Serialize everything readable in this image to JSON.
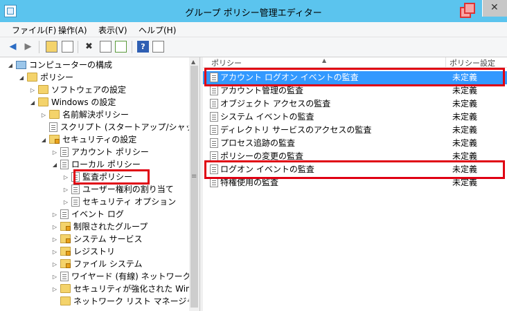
{
  "window": {
    "title": "グループ ポリシー管理エディター",
    "close_glyph": "✕"
  },
  "menubar": [
    "ファイル(F)",
    "操作(A)",
    "表示(V)",
    "ヘルプ(H)"
  ],
  "toolbar": {
    "help_glyph": "?",
    "delete_glyph": "✖"
  },
  "tree": [
    {
      "label": "コンピューターの構成",
      "icon": "computer-icon",
      "expander": "◢"
    },
    {
      "label": "ポリシー",
      "icon": "folder-icon",
      "expander": "◢"
    },
    {
      "label": "ソフトウェアの設定",
      "icon": "folder-icon",
      "expander": "▷"
    },
    {
      "label": "Windows の設定",
      "icon": "folder-icon",
      "expander": "◢"
    },
    {
      "label": "名前解決ポリシー",
      "icon": "folder-icon",
      "expander": "▷"
    },
    {
      "label": "スクリプト (スタートアップ/シャットダウ",
      "icon": "script-icon",
      "expander": ""
    },
    {
      "label": "セキュリティの設定",
      "icon": "security-folder-icon",
      "expander": "◢"
    },
    {
      "label": "アカウント ポリシー",
      "icon": "policy-icon",
      "expander": "▷"
    },
    {
      "label": "ローカル ポリシー",
      "icon": "policy-icon",
      "expander": "◢"
    },
    {
      "label": "監査ポリシー",
      "icon": "policy-icon",
      "expander": "▷"
    },
    {
      "label": "ユーザー権利の割り当て",
      "icon": "policy-icon",
      "expander": "▷"
    },
    {
      "label": "セキュリティ オプション",
      "icon": "policy-icon",
      "expander": "▷"
    },
    {
      "label": "イベント ログ",
      "icon": "policy-icon",
      "expander": "▷"
    },
    {
      "label": "制限されたグループ",
      "icon": "lock-folder-icon",
      "expander": "▷"
    },
    {
      "label": "システム サービス",
      "icon": "lock-folder-icon",
      "expander": "▷"
    },
    {
      "label": "レジストリ",
      "icon": "lock-folder-icon",
      "expander": "▷"
    },
    {
      "label": "ファイル システム",
      "icon": "lock-folder-icon",
      "expander": "▷"
    },
    {
      "label": "ワイヤード (有線) ネットワーク",
      "icon": "policy-icon",
      "expander": "▷"
    },
    {
      "label": "セキュリティが強化された Windo",
      "icon": "folder-icon",
      "expander": "▷"
    },
    {
      "label": "ネットワーク リスト マネージャー",
      "icon": "folder-icon",
      "expander": ""
    }
  ],
  "list": {
    "columns": {
      "name": "ポリシー",
      "setting": "ポリシー設定"
    },
    "rows": [
      {
        "name": "アカウント ログオン イベントの監査",
        "setting": "未定義"
      },
      {
        "name": "アカウント管理の監査",
        "setting": "未定義"
      },
      {
        "name": "オブジェクト アクセスの監査",
        "setting": "未定義"
      },
      {
        "name": "システム イベントの監査",
        "setting": "未定義"
      },
      {
        "name": "ディレクトリ サービスのアクセスの監査",
        "setting": "未定義"
      },
      {
        "name": "プロセス追跡の監査",
        "setting": "未定義"
      },
      {
        "name": "ポリシーの変更の監査",
        "setting": "未定義"
      },
      {
        "name": "ログオン イベントの監査",
        "setting": "未定義"
      },
      {
        "name": "特権使用の監査",
        "setting": "未定義"
      }
    ]
  },
  "colors": {
    "titlebar": "#5bc4ee",
    "selection": "#3399ff",
    "highlight": "#e00012"
  }
}
